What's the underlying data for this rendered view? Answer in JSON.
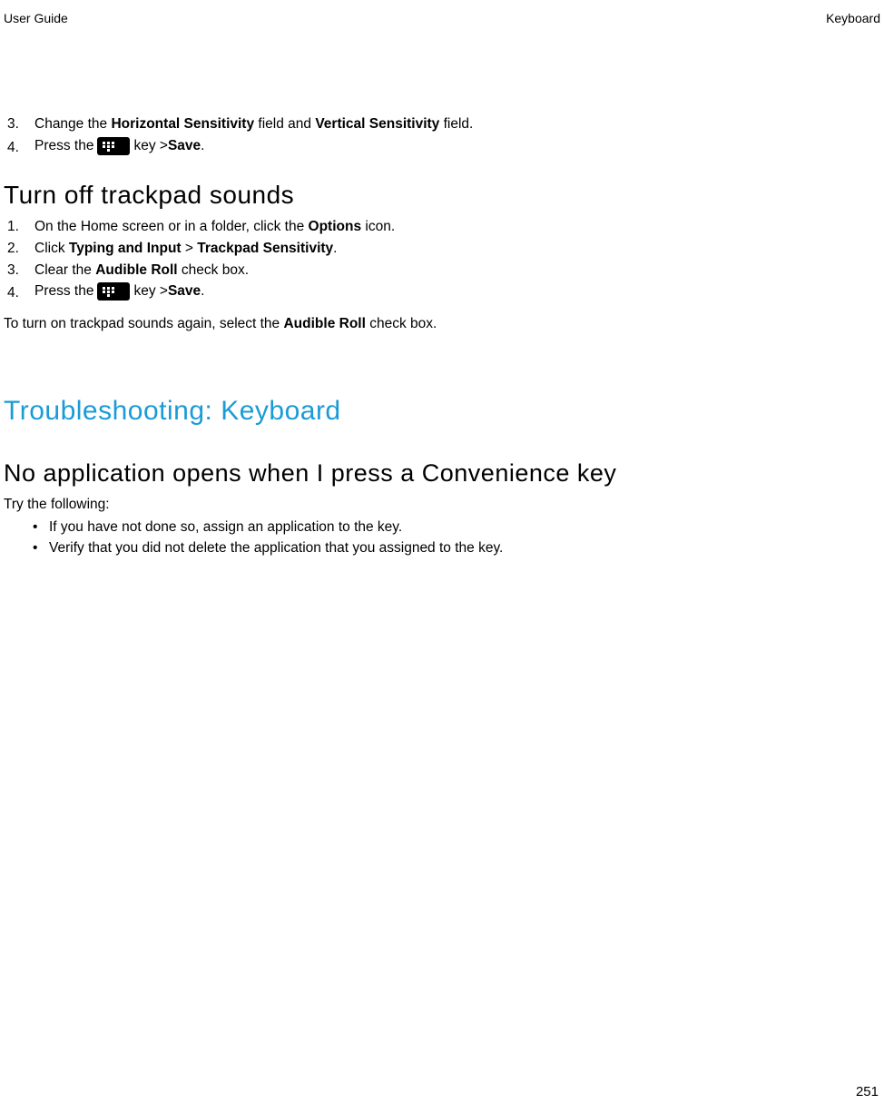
{
  "header": {
    "left": "User Guide",
    "right": "Keyboard"
  },
  "continued_steps": {
    "step3_num": "3.",
    "step3_pre": "Change the ",
    "step3_b1": "Horizontal Sensitivity",
    "step3_mid": " field and ",
    "step3_b2": "Vertical Sensitivity",
    "step3_post": " field.",
    "step4_num": "4.",
    "step4_pre": "Press the ",
    "step4_mid": " key > ",
    "step4_b1": "Save",
    "step4_post": "."
  },
  "section1": {
    "title": "Turn off trackpad sounds",
    "step1_num": "1.",
    "step1_pre": "On the Home screen or in a folder, click the ",
    "step1_b1": "Options",
    "step1_post": " icon.",
    "step2_num": "2.",
    "step2_pre": "Click ",
    "step2_b1": "Typing and Input",
    "step2_mid": " > ",
    "step2_b2": "Trackpad Sensitivity",
    "step2_post": ".",
    "step3_num": "3.",
    "step3_pre": "Clear the ",
    "step3_b1": "Audible Roll",
    "step3_post": " check box.",
    "step4_num": "4.",
    "step4_pre": "Press the ",
    "step4_mid": " key > ",
    "step4_b1": "Save",
    "step4_post": ".",
    "para_pre": "To turn on trackpad sounds again, select the ",
    "para_b1": "Audible Roll",
    "para_post": " check box."
  },
  "section2": {
    "main_title": "Troubleshooting: Keyboard",
    "sub_title": "No application opens when I press a Convenience key",
    "try_text": "Try the following:",
    "bullet1": "If you have not done so, assign an application to the key.",
    "bullet2": "Verify that you did not delete the application that you assigned to the key."
  },
  "page_number": "251"
}
